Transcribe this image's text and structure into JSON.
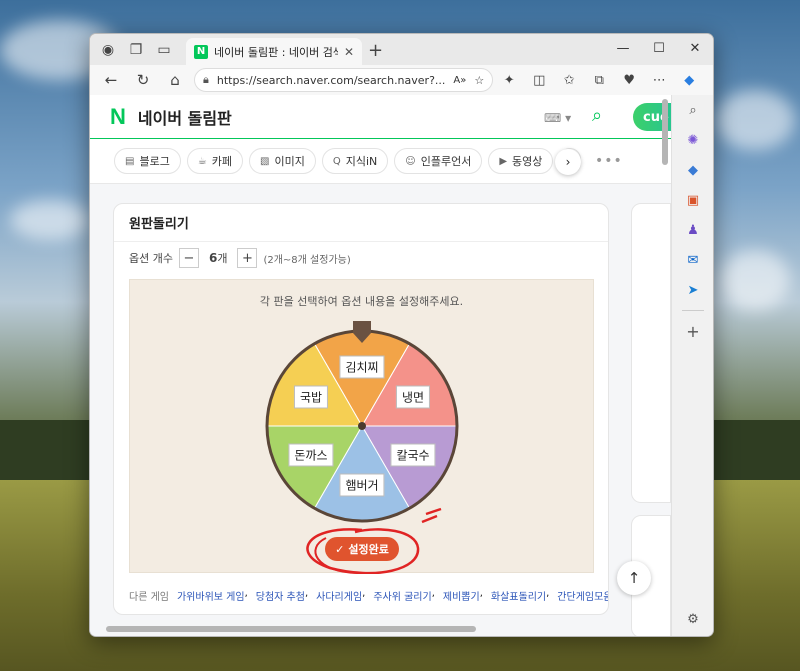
{
  "browser": {
    "tab_title": "네이버 돌림판 : 네이버 검색",
    "tab_favicon": "N",
    "url": "https://search.naver.com/search.naver?..."
  },
  "naver": {
    "logo": "N",
    "title": "네이버 돌림판",
    "cue_label": "cue"
  },
  "chips": [
    {
      "label": "블로그",
      "icon": "blog-icon"
    },
    {
      "label": "카페",
      "icon": "cafe-icon"
    },
    {
      "label": "이미지",
      "icon": "image-icon"
    },
    {
      "label": "지식iN",
      "icon": "knowledge-icon"
    },
    {
      "label": "인플루언서",
      "icon": "person-icon"
    },
    {
      "label": "동영상",
      "icon": "video-icon"
    }
  ],
  "roulette": {
    "title": "원판돌리기",
    "option_label": "옵션 개수",
    "option_count": "6",
    "option_unit": "개",
    "option_hint": "(2개~8개 설정가능)",
    "instruction": "각 판을 선택하여 옵션 내용을 설정해주세요.",
    "done_label": "설정완료",
    "segments": [
      {
        "label": "김치찌",
        "color": "#f2a448"
      },
      {
        "label": "냉면",
        "color": "#f4928a"
      },
      {
        "label": "칼국수",
        "color": "#b89bd3"
      },
      {
        "label": "햄버거",
        "color": "#9cc1e6"
      },
      {
        "label": "돈까스",
        "color": "#a8d467"
      },
      {
        "label": "국밥",
        "color": "#f5cf53"
      }
    ]
  },
  "other_games": {
    "label": "다른 게임",
    "links": [
      "가위바위보 게임",
      "당첨자 추첨",
      "사다리게임",
      "주사위 굴리기",
      "제비뽑기",
      "화살표돌리기",
      "간단게임모음"
    ]
  },
  "colors": {
    "naver_green": "#03c75a",
    "done_button": "#e0542e",
    "annotation_red": "#e02424"
  }
}
